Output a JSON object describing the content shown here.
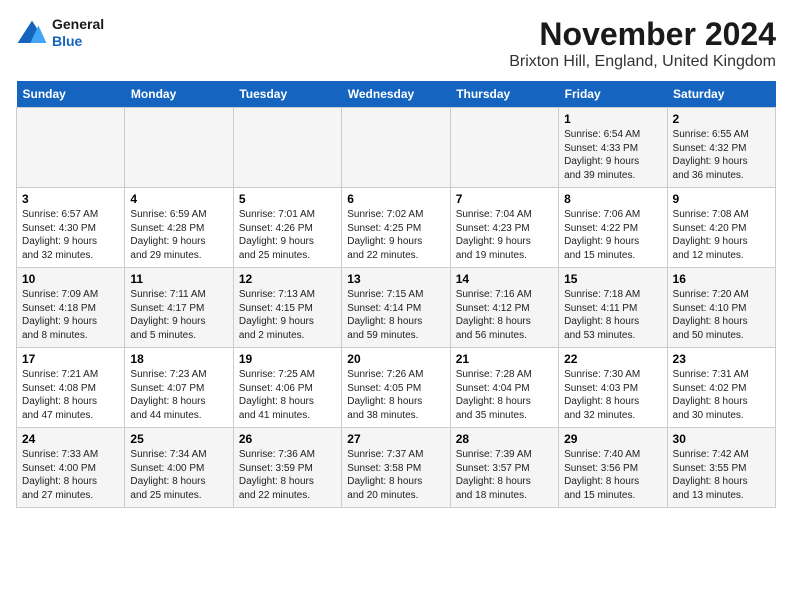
{
  "header": {
    "logo_line1": "General",
    "logo_line2": "Blue",
    "title": "November 2024",
    "subtitle": "Brixton Hill, England, United Kingdom"
  },
  "columns": [
    "Sunday",
    "Monday",
    "Tuesday",
    "Wednesday",
    "Thursday",
    "Friday",
    "Saturday"
  ],
  "weeks": [
    [
      {
        "day": "",
        "info": ""
      },
      {
        "day": "",
        "info": ""
      },
      {
        "day": "",
        "info": ""
      },
      {
        "day": "",
        "info": ""
      },
      {
        "day": "",
        "info": ""
      },
      {
        "day": "1",
        "info": "Sunrise: 6:54 AM\nSunset: 4:33 PM\nDaylight: 9 hours\nand 39 minutes."
      },
      {
        "day": "2",
        "info": "Sunrise: 6:55 AM\nSunset: 4:32 PM\nDaylight: 9 hours\nand 36 minutes."
      }
    ],
    [
      {
        "day": "3",
        "info": "Sunrise: 6:57 AM\nSunset: 4:30 PM\nDaylight: 9 hours\nand 32 minutes."
      },
      {
        "day": "4",
        "info": "Sunrise: 6:59 AM\nSunset: 4:28 PM\nDaylight: 9 hours\nand 29 minutes."
      },
      {
        "day": "5",
        "info": "Sunrise: 7:01 AM\nSunset: 4:26 PM\nDaylight: 9 hours\nand 25 minutes."
      },
      {
        "day": "6",
        "info": "Sunrise: 7:02 AM\nSunset: 4:25 PM\nDaylight: 9 hours\nand 22 minutes."
      },
      {
        "day": "7",
        "info": "Sunrise: 7:04 AM\nSunset: 4:23 PM\nDaylight: 9 hours\nand 19 minutes."
      },
      {
        "day": "8",
        "info": "Sunrise: 7:06 AM\nSunset: 4:22 PM\nDaylight: 9 hours\nand 15 minutes."
      },
      {
        "day": "9",
        "info": "Sunrise: 7:08 AM\nSunset: 4:20 PM\nDaylight: 9 hours\nand 12 minutes."
      }
    ],
    [
      {
        "day": "10",
        "info": "Sunrise: 7:09 AM\nSunset: 4:18 PM\nDaylight: 9 hours\nand 8 minutes."
      },
      {
        "day": "11",
        "info": "Sunrise: 7:11 AM\nSunset: 4:17 PM\nDaylight: 9 hours\nand 5 minutes."
      },
      {
        "day": "12",
        "info": "Sunrise: 7:13 AM\nSunset: 4:15 PM\nDaylight: 9 hours\nand 2 minutes."
      },
      {
        "day": "13",
        "info": "Sunrise: 7:15 AM\nSunset: 4:14 PM\nDaylight: 8 hours\nand 59 minutes."
      },
      {
        "day": "14",
        "info": "Sunrise: 7:16 AM\nSunset: 4:12 PM\nDaylight: 8 hours\nand 56 minutes."
      },
      {
        "day": "15",
        "info": "Sunrise: 7:18 AM\nSunset: 4:11 PM\nDaylight: 8 hours\nand 53 minutes."
      },
      {
        "day": "16",
        "info": "Sunrise: 7:20 AM\nSunset: 4:10 PM\nDaylight: 8 hours\nand 50 minutes."
      }
    ],
    [
      {
        "day": "17",
        "info": "Sunrise: 7:21 AM\nSunset: 4:08 PM\nDaylight: 8 hours\nand 47 minutes."
      },
      {
        "day": "18",
        "info": "Sunrise: 7:23 AM\nSunset: 4:07 PM\nDaylight: 8 hours\nand 44 minutes."
      },
      {
        "day": "19",
        "info": "Sunrise: 7:25 AM\nSunset: 4:06 PM\nDaylight: 8 hours\nand 41 minutes."
      },
      {
        "day": "20",
        "info": "Sunrise: 7:26 AM\nSunset: 4:05 PM\nDaylight: 8 hours\nand 38 minutes."
      },
      {
        "day": "21",
        "info": "Sunrise: 7:28 AM\nSunset: 4:04 PM\nDaylight: 8 hours\nand 35 minutes."
      },
      {
        "day": "22",
        "info": "Sunrise: 7:30 AM\nSunset: 4:03 PM\nDaylight: 8 hours\nand 32 minutes."
      },
      {
        "day": "23",
        "info": "Sunrise: 7:31 AM\nSunset: 4:02 PM\nDaylight: 8 hours\nand 30 minutes."
      }
    ],
    [
      {
        "day": "24",
        "info": "Sunrise: 7:33 AM\nSunset: 4:00 PM\nDaylight: 8 hours\nand 27 minutes."
      },
      {
        "day": "25",
        "info": "Sunrise: 7:34 AM\nSunset: 4:00 PM\nDaylight: 8 hours\nand 25 minutes."
      },
      {
        "day": "26",
        "info": "Sunrise: 7:36 AM\nSunset: 3:59 PM\nDaylight: 8 hours\nand 22 minutes."
      },
      {
        "day": "27",
        "info": "Sunrise: 7:37 AM\nSunset: 3:58 PM\nDaylight: 8 hours\nand 20 minutes."
      },
      {
        "day": "28",
        "info": "Sunrise: 7:39 AM\nSunset: 3:57 PM\nDaylight: 8 hours\nand 18 minutes."
      },
      {
        "day": "29",
        "info": "Sunrise: 7:40 AM\nSunset: 3:56 PM\nDaylight: 8 hours\nand 15 minutes."
      },
      {
        "day": "30",
        "info": "Sunrise: 7:42 AM\nSunset: 3:55 PM\nDaylight: 8 hours\nand 13 minutes."
      }
    ]
  ]
}
